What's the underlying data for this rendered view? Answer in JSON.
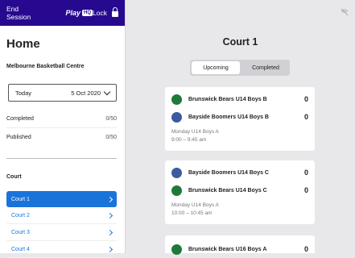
{
  "topbar": {
    "end_session": "End Session",
    "brand": "Play",
    "brand_badge": "HQ",
    "lock": "Lock"
  },
  "sidebar": {
    "title": "Home",
    "venue": "Melbourne Basketball Centre",
    "date_select": {
      "day": "Today",
      "date": "5 Oct 2020"
    },
    "stats": [
      {
        "label": "Completed",
        "value": "0/50"
      },
      {
        "label": "Published",
        "value": "0/50"
      }
    ],
    "court_heading": "Court",
    "courts": [
      "Court 1",
      "Court 2",
      "Court 3",
      "Court 4"
    ]
  },
  "main": {
    "title": "Court 1",
    "tabs": [
      "Upcoming",
      "Completed"
    ],
    "matches": [
      {
        "team1": "Brunswick Bears U14 Boys B",
        "score1": "0",
        "team2": "Bayside Boomers U14 Boys B",
        "score2": "0",
        "division": "Monday U14 Boys A",
        "time": "9:00 – 9:45 am"
      },
      {
        "team1": "Bayside Boomers U14 Boys C",
        "score1": "0",
        "team2": "Brunswick Bears U14 Boys C",
        "score2": "0",
        "division": "Monday U14 Boys A",
        "time": "10:00 – 10:45 am"
      },
      {
        "team1": "Brunswick Bears U16 Boys A",
        "score1": "0"
      }
    ]
  },
  "colors": {
    "brand": "#27098f",
    "accent": "#1a73d9",
    "bears": "#1f7a3a",
    "boomers": "#3a5ba0"
  },
  "icons": [
    "lock-icon",
    "chevron-down-icon",
    "chevron-right-icon",
    "wifi-off-icon",
    "bears-logo",
    "boomers-logo"
  ]
}
